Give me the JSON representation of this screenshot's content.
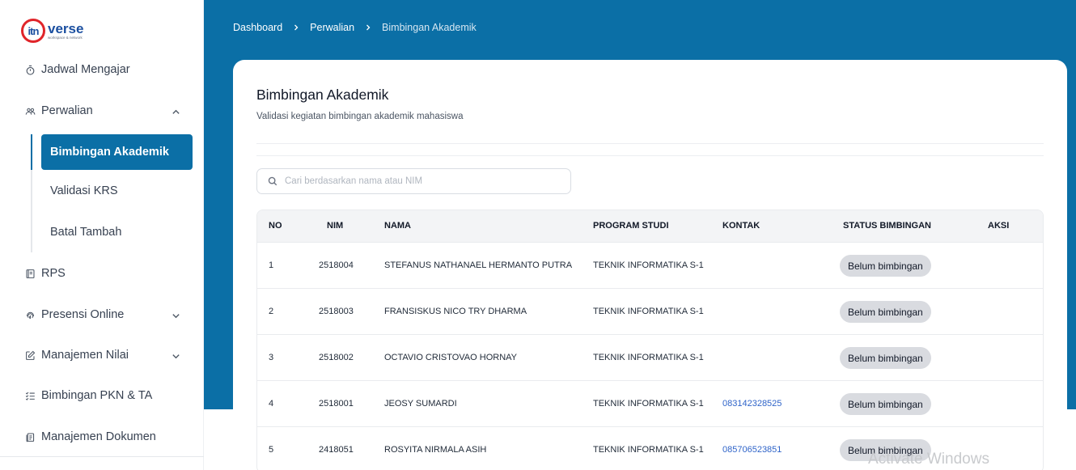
{
  "brand": {
    "mark": "itn",
    "word": "verse",
    "tagline": "workspace & network"
  },
  "sidebar": {
    "items": [
      {
        "label": "Jadwal Mengajar"
      },
      {
        "label": "Perwalian"
      },
      {
        "label": "RPS"
      },
      {
        "label": "Presensi Online"
      },
      {
        "label": "Manajemen Nilai"
      },
      {
        "label": "Bimbingan PKN & TA"
      },
      {
        "label": "Manajemen Dokumen"
      }
    ],
    "sub_items": [
      {
        "label": "Bimbingan Akademik",
        "active": true
      },
      {
        "label": "Validasi KRS"
      },
      {
        "label": "Batal Tambah"
      }
    ]
  },
  "breadcrumb": [
    "Dashboard",
    "Perwalian",
    "Bimbingan Akademik"
  ],
  "page": {
    "title": "Bimbingan Akademik",
    "subtitle": "Validasi kegiatan bimbingan akademik mahasiswa"
  },
  "search": {
    "placeholder": "Cari berdasarkan nama atau NIM",
    "value": ""
  },
  "table": {
    "columns": [
      "NO",
      "NIM",
      "NAMA",
      "PROGRAM STUDI",
      "KONTAK",
      "STATUS BIMBINGAN",
      "AKSI"
    ],
    "rows": [
      {
        "no": "1",
        "nim": "2518004",
        "nama": "STEFANUS NATHANAEL HERMANTO PUTRA",
        "prodi": "TEKNIK INFORMATIKA S-1",
        "kontak": "",
        "status": "Belum bimbingan"
      },
      {
        "no": "2",
        "nim": "2518003",
        "nama": "FRANSISKUS NICO TRY DHARMA",
        "prodi": "TEKNIK INFORMATIKA S-1",
        "kontak": "",
        "status": "Belum bimbingan"
      },
      {
        "no": "3",
        "nim": "2518002",
        "nama": "OCTAVIO CRISTOVAO HORNAY",
        "prodi": "TEKNIK INFORMATIKA S-1",
        "kontak": "",
        "status": "Belum bimbingan"
      },
      {
        "no": "4",
        "nim": "2518001",
        "nama": "JEOSY SUMARDI",
        "prodi": "TEKNIK INFORMATIKA S-1",
        "kontak": "083142328525",
        "status": "Belum bimbingan"
      },
      {
        "no": "5",
        "nim": "2418051",
        "nama": "ROSYITA NIRMALA ASIH",
        "prodi": "TEKNIK INFORMATIKA S-1",
        "kontak": "085706523851",
        "status": "Belum bimbingan"
      }
    ]
  },
  "colors": {
    "primary": "#0b6fa6",
    "badge_bg": "#d9dbe0",
    "link": "#2f64c9"
  },
  "watermark": "Activate Windows"
}
